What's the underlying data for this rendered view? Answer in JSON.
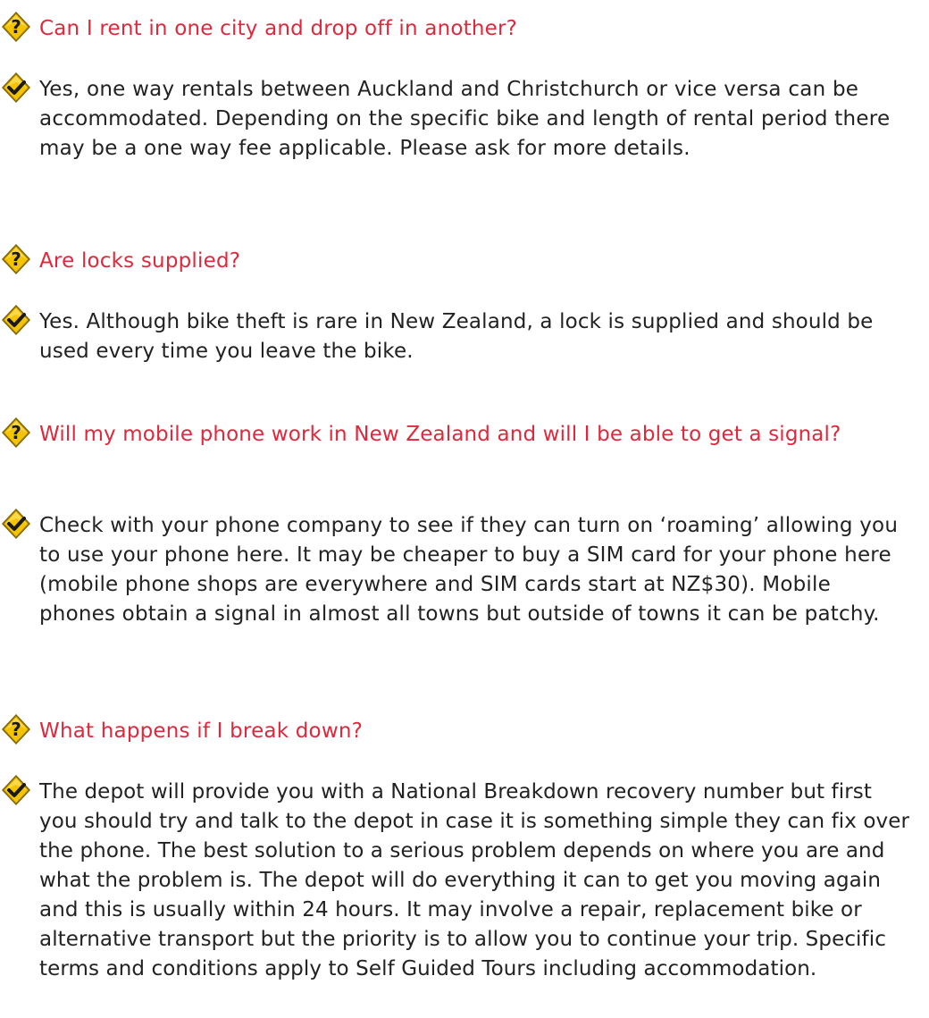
{
  "faq": [
    {
      "question": "Can I rent in one city and drop off in another?",
      "answer": "Yes, one way rentals between Auckland and Christchurch or vice versa can be accommodated. Depending on the specific bike and length of rental period there may be a one way fee applicable. Please ask for more details."
    },
    {
      "question": "Are locks supplied?",
      "answer": "Yes. Although bike theft is rare in New Zealand, a lock is supplied and should be used every time you leave the bike."
    },
    {
      "question": "Will my mobile phone work in New Zealand and will I be able to get a signal?",
      "answer": "Check with your phone company to see if they can turn on ‘roaming’ allowing you to use your phone here. It may be cheaper to buy a SIM card for your phone here (mobile phone shops are everywhere and SIM cards start at NZ$30). Mobile phones obtain a signal in almost all towns but outside of towns it can be patchy."
    },
    {
      "question": "What happens if I break down?",
      "answer": "The depot will provide you with a National Breakdown recovery number but first you should try and talk to the depot in case it is something simple they can fix over the phone. The best solution to a serious problem depends on where you are and what the problem is. The depot will do everything it can to get you moving again and this is usually within 24 hours. It may involve a repair, replacement bike or alternative transport but the priority is to allow you to continue your trip. Specific terms and conditions apply to Self Guided Tours including accommodation."
    }
  ],
  "icons": {
    "question": "question-mark-icon",
    "answer": "check-mark-icon",
    "badge_fill": "#f5c400",
    "badge_edge": "#9a7a00",
    "question_color": "#e0283c",
    "answer_color": "#222222"
  }
}
